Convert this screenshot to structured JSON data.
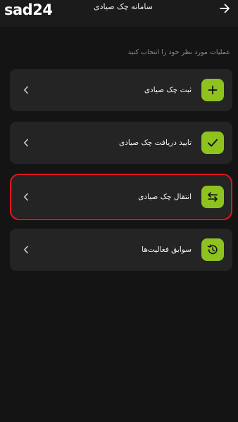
{
  "watermark": "sad24",
  "header": {
    "title": "سامانه چک صیادی"
  },
  "hint": "عملیات مورد نظر خود را انتخاب کنید",
  "options": [
    {
      "label": "ثبت چک صیادی",
      "icon": "plus-icon"
    },
    {
      "label": "تایید دریافت چک صیادی",
      "icon": "check-icon"
    },
    {
      "label": "انتقال چک صیادی",
      "icon": "transfer-arrows-icon",
      "highlighted": true
    },
    {
      "label": "سوابق فعالیت‌ها",
      "icon": "history-icon"
    }
  ],
  "colors": {
    "accent": "#8dc21f",
    "highlight": "#e4141d",
    "background": "#141414",
    "card": "#242424"
  }
}
